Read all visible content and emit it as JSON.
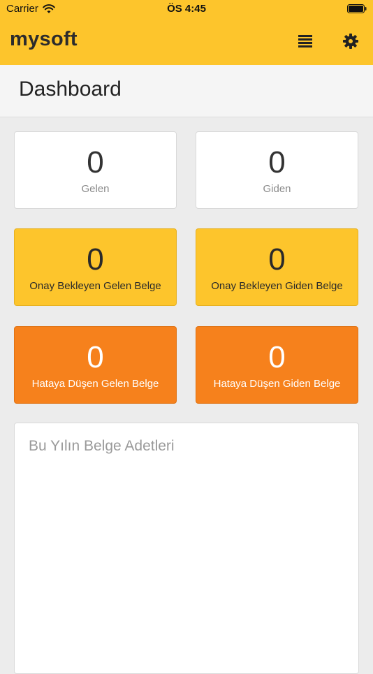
{
  "status_bar": {
    "carrier": "Carrier",
    "time": "ÖS 4:45"
  },
  "header": {
    "brand": "mysoft",
    "menu_icon": "list-icon",
    "settings_icon": "gear-icon"
  },
  "page": {
    "title": "Dashboard"
  },
  "cards": [
    {
      "count": "0",
      "label": "Gelen",
      "style": "white"
    },
    {
      "count": "0",
      "label": "Giden",
      "style": "white"
    },
    {
      "count": "0",
      "label": "Onay Bekleyen Gelen Belge",
      "style": "yellow"
    },
    {
      "count": "0",
      "label": "Onay Bekleyen Giden Belge",
      "style": "yellow"
    },
    {
      "count": "0",
      "label": "Hataya Düşen Gelen Belge",
      "style": "orange"
    },
    {
      "count": "0",
      "label": "Hataya Düşen Giden Belge",
      "style": "orange"
    }
  ],
  "chart_panel": {
    "title": "Bu Yılın Belge Adetleri"
  },
  "colors": {
    "accent": "#fdc52c",
    "warning": "#f6811c",
    "background": "#ececec"
  }
}
